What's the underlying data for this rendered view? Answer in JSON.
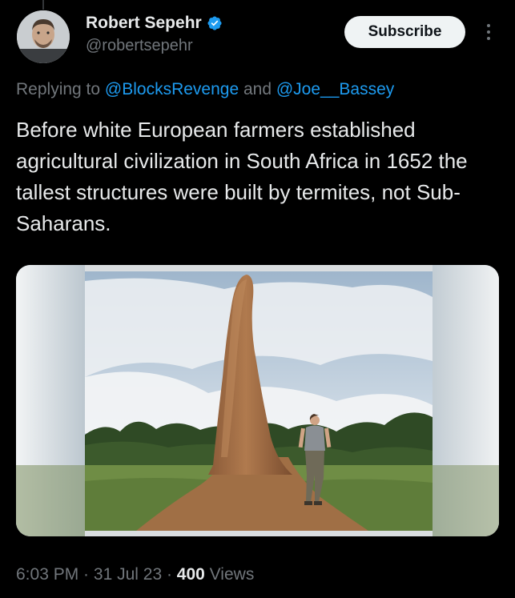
{
  "author": {
    "display_name": "Robert Sepehr",
    "handle": "@robertsepehr",
    "verified": true
  },
  "subscribe_label": "Subscribe",
  "reply": {
    "prefix": "Replying to ",
    "mention_1": "@BlocksRevenge",
    "conjunction": " and ",
    "mention_2": "@Joe__Bassey"
  },
  "tweet_text": "Before white European farmers established agricultural civilization in South Africa in 1652 the tallest structures were built by termites, not Sub-Saharans.",
  "meta": {
    "time": "6:03 PM",
    "separator_1": " · ",
    "date": "31 Jul 23",
    "separator_2": " · ",
    "views_count": "400",
    "views_label": " Views"
  },
  "colors": {
    "background": "#000000",
    "accent": "#1d9bf0",
    "text_primary": "#e7e9ea",
    "text_secondary": "#71767b"
  },
  "icons": {
    "verified": "verified-badge-icon",
    "more": "more-vertical-icon"
  }
}
